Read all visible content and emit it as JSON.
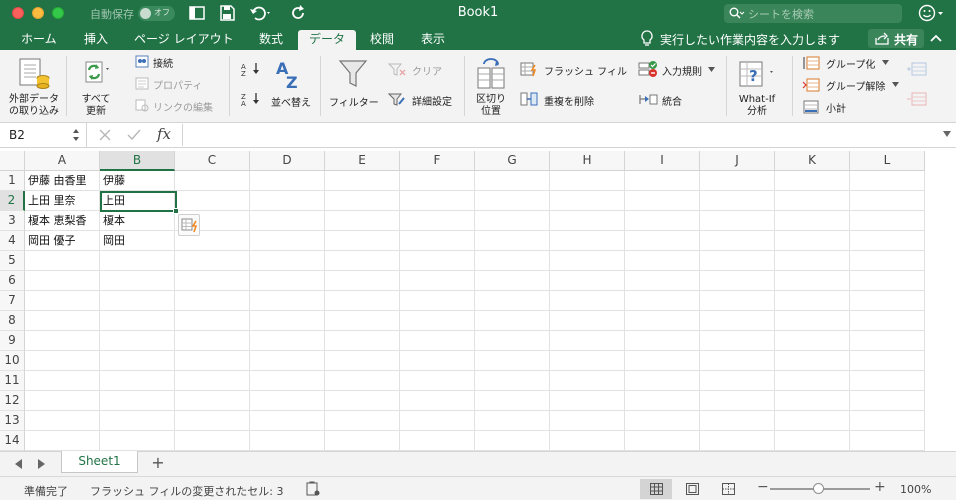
{
  "window": {
    "title": "Book1",
    "autosave_label": "自動保存",
    "autosave_state": "オフ",
    "search_placeholder": "シートを検索"
  },
  "tabs": [
    {
      "label": "ホーム"
    },
    {
      "label": "挿入"
    },
    {
      "label": "ページ レイアウト"
    },
    {
      "label": "数式"
    },
    {
      "label": "データ",
      "active": true
    },
    {
      "label": "校閲"
    },
    {
      "label": "表示"
    }
  ],
  "tell_me": "実行したい作業内容を入力します",
  "share_label": "共有",
  "ribbon": {
    "external_data": "外部データ\nの取り込み",
    "refresh_all": "すべて\n更新",
    "connections": "接続",
    "properties": "プロパティ",
    "edit_links": "リンクの編集",
    "sort": "並べ替え",
    "filter": "フィルター",
    "clear": "クリア",
    "advanced": "詳細設定",
    "text_to_columns": "区切り\n位置",
    "flash_fill": "フラッシュ フィル",
    "remove_duplicates": "重複を削除",
    "data_validation": "入力規則",
    "consolidate": "統合",
    "what_if": "What-If\n分析",
    "group": "グループ化",
    "ungroup": "グループ解除",
    "subtotal": "小計"
  },
  "formula_bar": {
    "name_box": "B2",
    "fx": "fx",
    "content": ""
  },
  "grid": {
    "columns": [
      "A",
      "B",
      "C",
      "D",
      "E",
      "F",
      "G",
      "H",
      "I",
      "J",
      "K",
      "L"
    ],
    "rows": [
      "1",
      "2",
      "3",
      "4",
      "5",
      "6",
      "7",
      "8",
      "9",
      "10",
      "11",
      "12",
      "13",
      "14"
    ],
    "selected_col": "B",
    "selected_row": "2",
    "cells": {
      "A1": "伊藤 由香里",
      "B1": "伊藤",
      "A2": "上田 里奈",
      "B2": "上田",
      "A3": "榎本 恵梨香",
      "B3": "榎本",
      "A4": "岡田 優子",
      "B4": "岡田"
    }
  },
  "sheets": [
    {
      "name": "Sheet1"
    }
  ],
  "status": {
    "ready": "準備完了",
    "message": "フラッシュ フィルの変更されたセル: 3",
    "zoom": "100%"
  },
  "colors": {
    "brand": "#217346",
    "ribbon_bg": "#f3f3f3"
  }
}
